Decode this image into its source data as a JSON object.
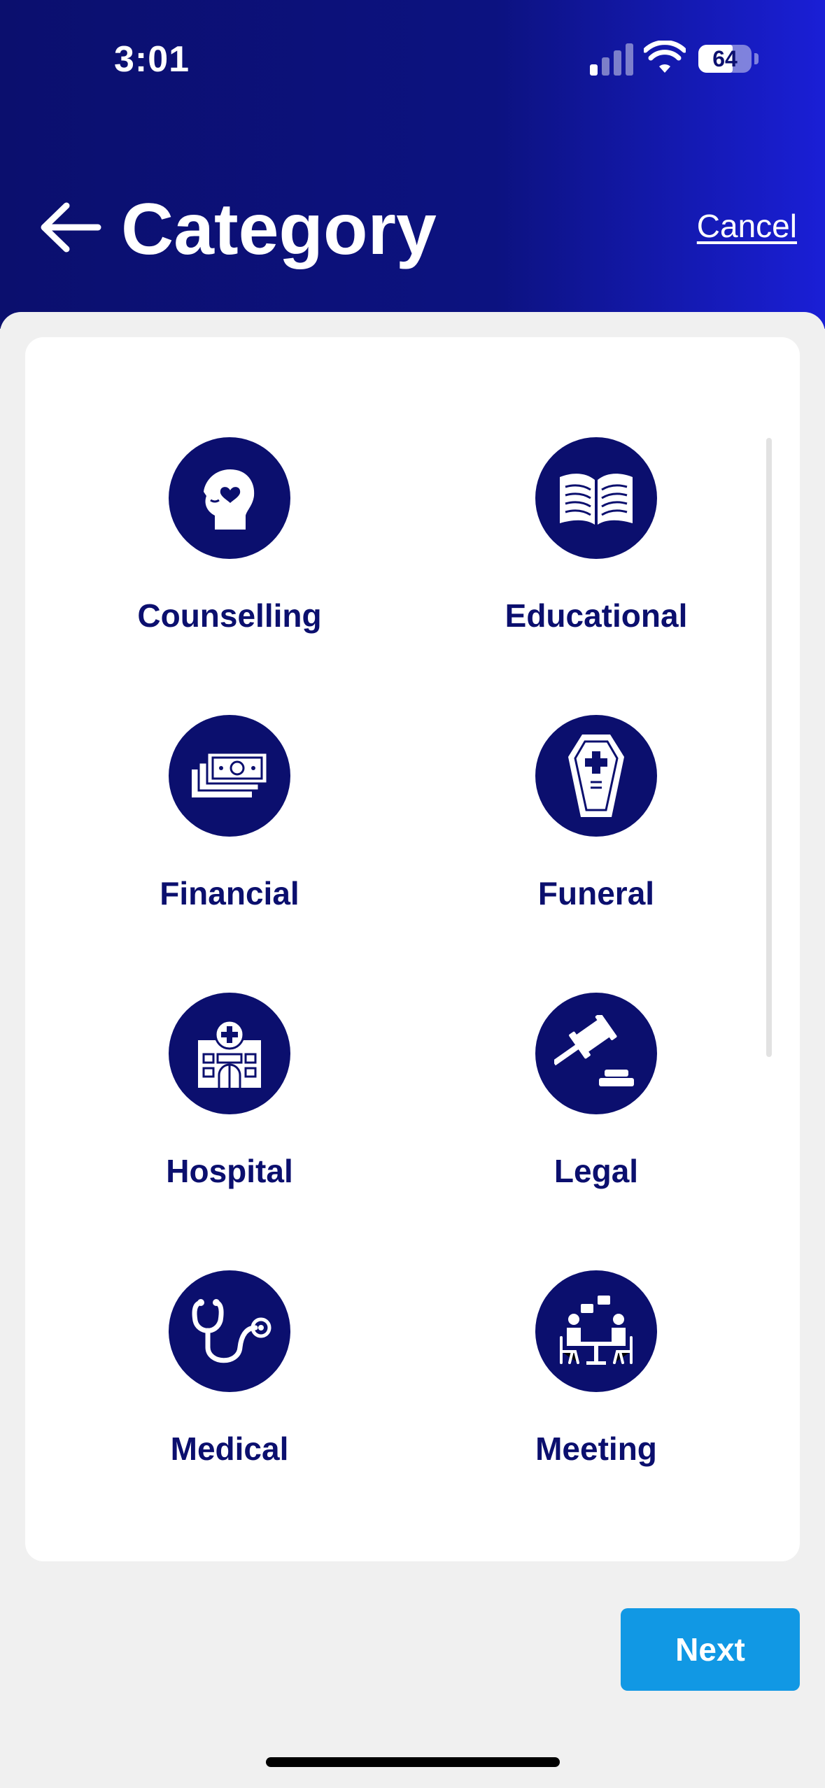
{
  "status_bar": {
    "time": "3:01",
    "battery": "64",
    "icons": [
      "signal-icon",
      "wifi-icon",
      "battery-icon"
    ]
  },
  "header": {
    "title": "Category",
    "cancel_label": "Cancel",
    "back_icon": "arrow-left-icon"
  },
  "categories": [
    {
      "label": "Counselling",
      "icon": "head-heart-icon"
    },
    {
      "label": "Educational",
      "icon": "open-book-icon"
    },
    {
      "label": "Financial",
      "icon": "money-icon"
    },
    {
      "label": "Funeral",
      "icon": "coffin-icon"
    },
    {
      "label": "Hospital",
      "icon": "hospital-icon"
    },
    {
      "label": "Legal",
      "icon": "gavel-icon"
    },
    {
      "label": "Medical",
      "icon": "stethoscope-icon"
    },
    {
      "label": "Meeting",
      "icon": "meeting-icon"
    }
  ],
  "footer": {
    "next_label": "Next"
  },
  "colors": {
    "primary_navy": "#0b0f6e",
    "header_gradient_end": "#1a1fd6",
    "button_blue": "#1198e4",
    "background": "#f0f0f0"
  }
}
